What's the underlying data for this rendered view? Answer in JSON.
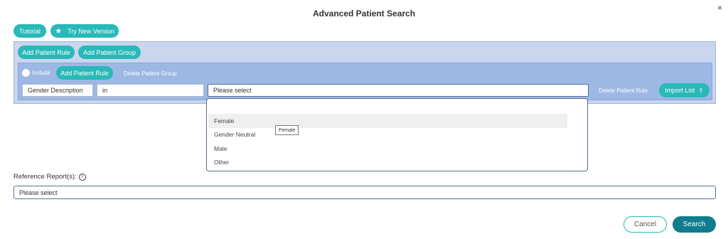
{
  "dialog": {
    "title": "Advanced Patient Search",
    "close_icon": "×"
  },
  "top_buttons": {
    "tutorial": "Tutorial",
    "try_new_version": "Try New Version",
    "star_icon": "★"
  },
  "outer_group": {
    "add_rule": "Add Patient Rule",
    "add_group": "Add Patient Group"
  },
  "inner_group": {
    "include_label": "Include",
    "add_rule": "Add Patient Rule",
    "delete_group": "Delete Patient Group",
    "rule": {
      "attribute": "Gender Description",
      "operator": "in",
      "value_placeholder": "Please select",
      "delete_rule": "Delete Patient Rule",
      "import_list": "Import List",
      "import_icon": "⇪"
    }
  },
  "dropdown": {
    "options": [
      "Female",
      "Gender Neutral",
      "Male",
      "Other"
    ],
    "highlighted": "Female",
    "tooltip": "Female"
  },
  "reference": {
    "label": "Reference Report(s):",
    "info_icon": "i",
    "placeholder": "Please select"
  },
  "footer": {
    "cancel": "Cancel",
    "search": "Search"
  },
  "colors": {
    "accent": "#28b9b8",
    "primary": "#117c8d",
    "outer_group_bg": "#c9d6ee",
    "inner_group_bg": "#9db8e4"
  }
}
